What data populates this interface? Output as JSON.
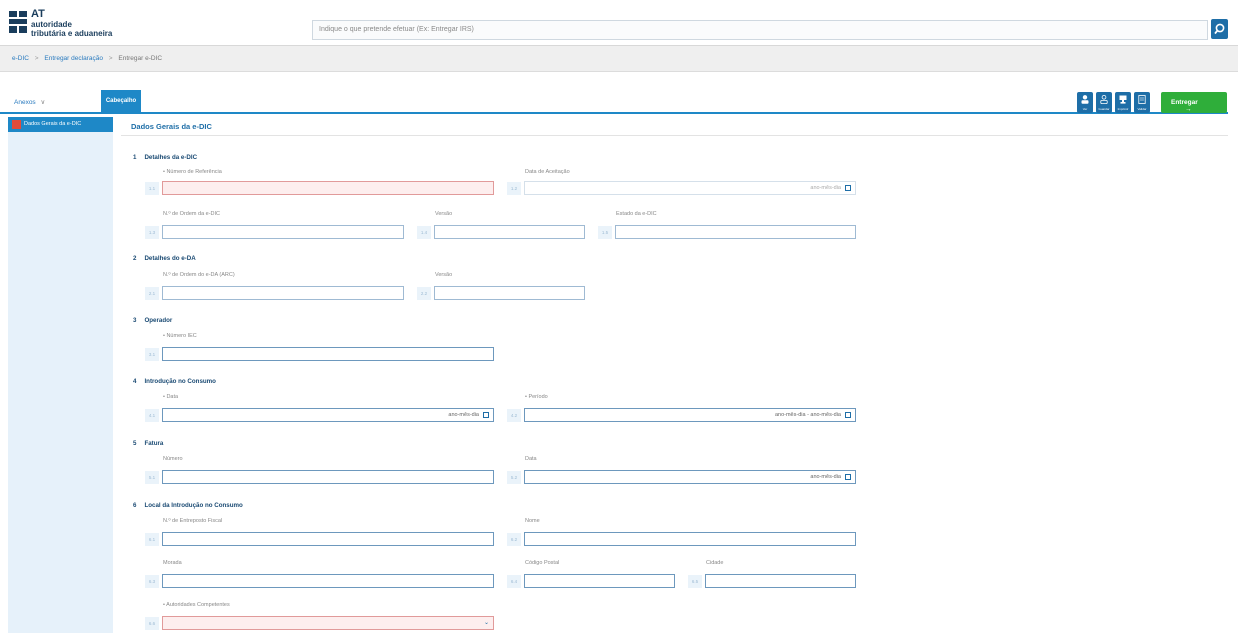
{
  "header": {
    "logo_at": "AT",
    "logo_line1": "autoridade",
    "logo_line2": "tributária e aduaneira",
    "search_placeholder": "Indique o que pretende efetuar (Ex: Entregar IRS)"
  },
  "breadcrumb": {
    "items": [
      "e-DIC",
      "Entregar declaração",
      "Entregar e-DIC"
    ],
    "separator": ">"
  },
  "tabs": {
    "anexos_label": "Anexos",
    "anexos_chevron": "∨",
    "cabecalho_label": "Cabeçalho"
  },
  "toolbar": {
    "buttons": [
      {
        "icon": "user-icon",
        "caption": "Ver"
      },
      {
        "icon": "user-outline-icon",
        "caption": "Guardar"
      },
      {
        "icon": "trophy-icon",
        "caption": "Imprimir"
      },
      {
        "icon": "document-icon",
        "caption": "Validar"
      }
    ],
    "entregar_label": "Entregar",
    "entregar_arrow": "→"
  },
  "sidebar": {
    "item_label": "Dados Gerais da e-DIC"
  },
  "main": {
    "title": "Dados Gerais da e-DIC",
    "sections": [
      {
        "num": "1",
        "title": "Detalhes da e-DIC"
      },
      {
        "num": "2",
        "title": "Detalhes do e-DA"
      },
      {
        "num": "3",
        "title": "Operador"
      },
      {
        "num": "4",
        "title": "Introdução no Consumo"
      },
      {
        "num": "5",
        "title": "Fatura"
      },
      {
        "num": "6",
        "title": "Local da Introdução no Consumo"
      }
    ],
    "fields": {
      "f1_1": {
        "num": "1.1",
        "label": "• Número de Referência",
        "value": ""
      },
      "f1_2": {
        "num": "1.2",
        "label": "Data de Aceitação",
        "value": "ano-mês-dia"
      },
      "f1_3": {
        "num": "1.3",
        "label": "N.º de Ordem da e-DIC",
        "value": ""
      },
      "f1_4": {
        "num": "1.4",
        "label": "Versão",
        "value": ""
      },
      "f1_5": {
        "num": "1.5",
        "label": "Estado da e-DIC",
        "value": ""
      },
      "f2_1": {
        "num": "2.1",
        "label": "N.º de Ordem do e-DA (ARC)",
        "value": ""
      },
      "f2_2": {
        "num": "2.2",
        "label": "Versão",
        "value": ""
      },
      "f3_1": {
        "num": "3.1",
        "label": "• Número IEC",
        "value": ""
      },
      "f4_1": {
        "num": "4.1",
        "label": "• Data",
        "value": "ano-mês-dia"
      },
      "f4_2": {
        "num": "4.2",
        "label": "• Período",
        "value": "ano-mês-dia - ano-mês-dia"
      },
      "f5_1": {
        "num": "5.1",
        "label": "Número",
        "value": ""
      },
      "f5_2": {
        "num": "5.2",
        "label": "Data",
        "value": "ano-mês-dia"
      },
      "f6_1": {
        "num": "6.1",
        "label": "N.º de Entreposto Fiscal",
        "value": ""
      },
      "f6_2": {
        "num": "6.2",
        "label": "Nome",
        "value": ""
      },
      "f6_3": {
        "num": "6.3",
        "label": "Morada",
        "value": ""
      },
      "f6_4": {
        "num": "6.4",
        "label": "Código Postal",
        "value": ""
      },
      "f6_5": {
        "num": "6.5",
        "label": "Cidade",
        "value": ""
      },
      "f6_6": {
        "num": "6.6",
        "label": "• Autoridades Competentes",
        "value": ""
      }
    }
  },
  "colors": {
    "primary": "#1e88c7",
    "dark_blue": "#1e6ea7",
    "green": "#2fae3a",
    "required": "#e19a9a",
    "sidebar_bg": "#e6f1fa"
  }
}
